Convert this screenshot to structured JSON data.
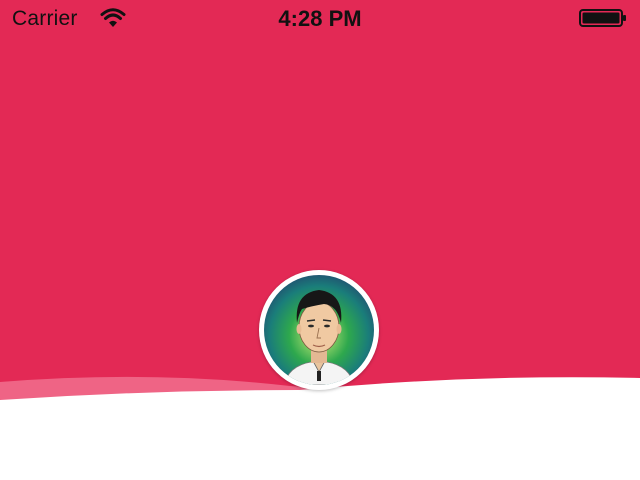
{
  "status_bar": {
    "carrier": "Carrier",
    "time": "4:28 PM",
    "wifi_icon": "wifi-icon",
    "battery_icon": "battery-full-icon"
  },
  "profile": {
    "avatar_icon": "user-avatar"
  },
  "colors": {
    "header": "#e32955",
    "wave_light": "#f06a8b",
    "background": "#ffffff"
  }
}
